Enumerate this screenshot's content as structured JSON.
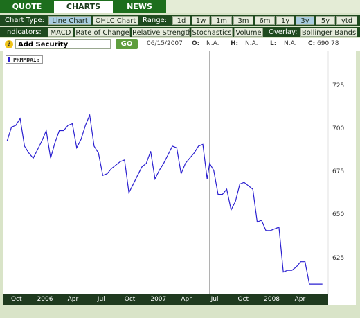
{
  "tabs": [
    {
      "label": "QUOTE",
      "active": false
    },
    {
      "label": "CHARTS",
      "active": true
    },
    {
      "label": "NEWS",
      "active": false
    }
  ],
  "chart_type": {
    "label": "Chart Type:",
    "options": [
      "Line Chart",
      "OHLC Chart"
    ],
    "selected": "Line Chart"
  },
  "range": {
    "label": "Range:",
    "options": [
      "1d",
      "1w",
      "1m",
      "3m",
      "6m",
      "1y",
      "3y",
      "5y",
      "ytd"
    ],
    "selected": "3y"
  },
  "indicators": {
    "label": "Indicators:",
    "options": [
      "MACD",
      "Rate of Change",
      "Relative Strength",
      "Stochastics",
      "Volume"
    ]
  },
  "overlay": {
    "label": "Overlay:",
    "options": [
      "Bollinger Bands"
    ]
  },
  "search": {
    "value": "Add Security",
    "go_label": "GO"
  },
  "quote": {
    "date": "06/15/2007",
    "o_label": "O:",
    "o": "N.A.",
    "h_label": "H:",
    "h": "N.A.",
    "l_label": "L:",
    "l": "N.A.",
    "c_label": "C:",
    "c": "690.78"
  },
  "colors": {
    "line": "#2a1fd0",
    "accent_green": "#1d6e1d",
    "selected_button": "#a9cde0"
  },
  "chart_data": {
    "type": "line",
    "title": "",
    "xlabel": "",
    "ylabel": "",
    "series": [
      {
        "name": "PRMMDAI:",
        "x": [
          "2005-09-01",
          "2005-09-15",
          "2005-09-29",
          "2005-10-13",
          "2005-10-27",
          "2005-11-10",
          "2005-11-24",
          "2005-12-08",
          "2005-12-22",
          "2006-01-05",
          "2006-01-19",
          "2006-02-02",
          "2006-02-16",
          "2006-03-02",
          "2006-03-16",
          "2006-03-30",
          "2006-04-13",
          "2006-04-27",
          "2006-05-11",
          "2006-05-25",
          "2006-06-08",
          "2006-06-22",
          "2006-07-06",
          "2006-07-20",
          "2006-08-03",
          "2006-08-17",
          "2006-08-31",
          "2006-09-14",
          "2006-09-28",
          "2006-10-12",
          "2006-10-26",
          "2006-11-09",
          "2006-11-23",
          "2006-12-07",
          "2006-12-21",
          "2007-01-04",
          "2007-01-18",
          "2007-02-01",
          "2007-02-15",
          "2007-03-01",
          "2007-03-15",
          "2007-03-29",
          "2007-04-12",
          "2007-04-26",
          "2007-05-10",
          "2007-05-24",
          "2007-06-07",
          "2007-06-15",
          "2007-06-28",
          "2007-07-12",
          "2007-07-26",
          "2007-08-09",
          "2007-08-23",
          "2007-09-06",
          "2007-09-20",
          "2007-10-04",
          "2007-10-18",
          "2007-11-01",
          "2007-11-15",
          "2007-11-29",
          "2007-12-13",
          "2007-12-27",
          "2008-01-10",
          "2008-01-24",
          "2008-02-07",
          "2008-02-21",
          "2008-03-06",
          "2008-03-20",
          "2008-04-03",
          "2008-04-17",
          "2008-05-01",
          "2008-05-15",
          "2008-05-29",
          "2008-06-12"
        ],
        "values": [
          693,
          701,
          702,
          706,
          690,
          686,
          683,
          688,
          693,
          699,
          683,
          692,
          699,
          699,
          702,
          703,
          689,
          694,
          702,
          708,
          690,
          686,
          673,
          674,
          677,
          679,
          681,
          682,
          663,
          668,
          673,
          678,
          680,
          687,
          671,
          676,
          680,
          685,
          690,
          689,
          674,
          680,
          683,
          686,
          690,
          691,
          671,
          680,
          676,
          662,
          662,
          665,
          653,
          658,
          668,
          669,
          667,
          665,
          646,
          647,
          641,
          641,
          642,
          643,
          617,
          618,
          618,
          620,
          623,
          623,
          610,
          610,
          610,
          610
        ]
      }
    ],
    "x_ticks": [
      "Oct",
      "2006",
      "Apr",
      "Jul",
      "Oct",
      "2007",
      "Apr",
      "Jul",
      "Oct",
      "2008",
      "Apr"
    ],
    "y_ticks": [
      625,
      650,
      675,
      700,
      725
    ],
    "ylim": [
      604,
      745
    ],
    "grid": false,
    "annotations": [
      {
        "type": "vertical-line",
        "x": "2007-06-15"
      }
    ]
  }
}
